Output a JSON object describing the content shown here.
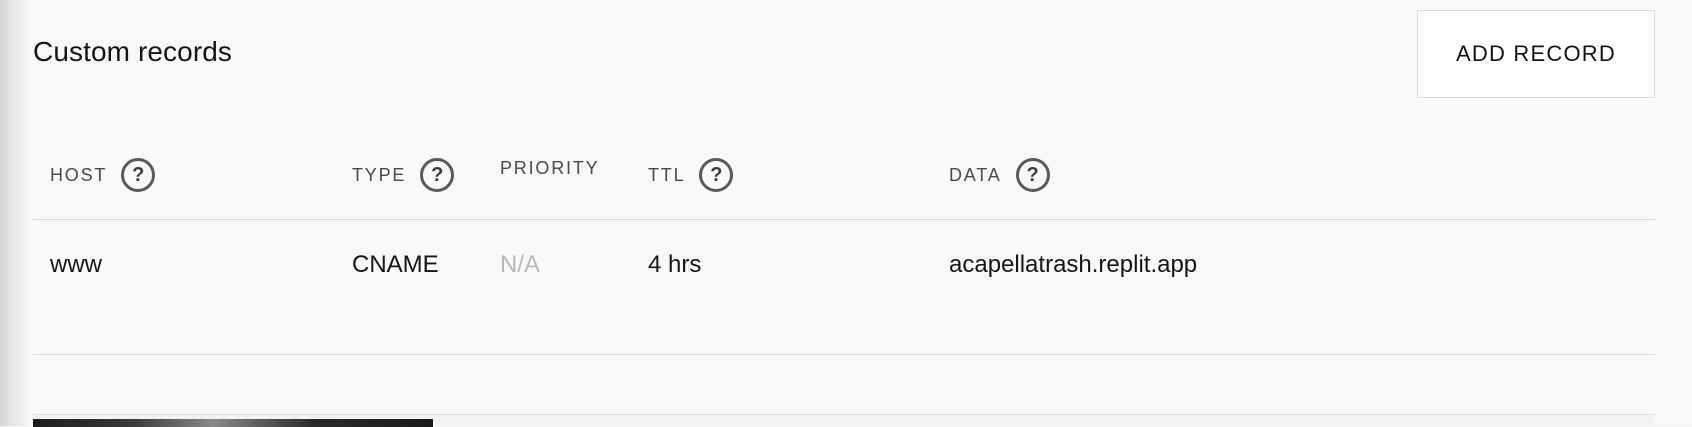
{
  "section": {
    "title": "Custom records",
    "add_button_label": "ADD RECORD"
  },
  "columns": [
    {
      "label": "HOST",
      "has_help": true
    },
    {
      "label": "TYPE",
      "has_help": true
    },
    {
      "label": "PRIORITY",
      "has_help": false
    },
    {
      "label": "TTL",
      "has_help": true
    },
    {
      "label": "DATA",
      "has_help": true
    }
  ],
  "help_icon_glyph": "?",
  "records": [
    {
      "host": "www",
      "type": "CNAME",
      "priority": "N/A",
      "ttl": "4 hrs",
      "data": "acapellatrash.replit.app"
    }
  ],
  "colors": {
    "background": "#f9f9f9",
    "text": "#151515",
    "muted": "#b9b9b9",
    "divider": "#d9d9d9"
  }
}
